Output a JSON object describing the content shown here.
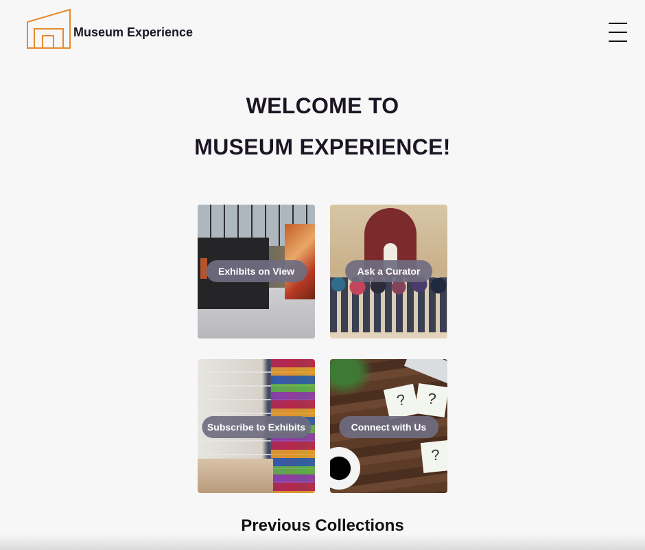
{
  "header": {
    "brand_name": "Museum Experience",
    "logo_icon": "museum-building-outline-icon",
    "menu_icon": "hamburger-menu-icon",
    "logo_color": "#e48a2c"
  },
  "hero": {
    "line1": "WELCOME TO",
    "line2": "MUSEUM EXPERIENCE!"
  },
  "tiles": [
    {
      "label": "Exhibits on View",
      "image": "gallery-interior-photo"
    },
    {
      "label": "Ask a Curator",
      "image": "visitors-at-statue-photo"
    },
    {
      "label": "Subscribe to Exhibits",
      "image": "art-supply-store-photo"
    },
    {
      "label": "Connect with Us",
      "image": "desk-question-notes-photo"
    }
  ],
  "sections": {
    "previous_collections": "Previous Collections"
  },
  "colors": {
    "background": "#f7f7f8",
    "heading_text": "#1b1523",
    "pill_background": "#6f6d80"
  }
}
